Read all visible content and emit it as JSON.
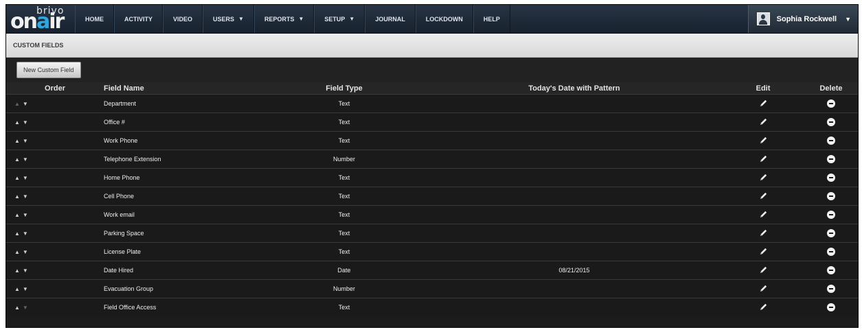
{
  "app": {
    "logo_top": "brivo",
    "logo_main_left": "on",
    "logo_main_accent": "a",
    "logo_main_right": "ir"
  },
  "nav": {
    "items": [
      {
        "label": "HOME",
        "dropdown": false
      },
      {
        "label": "ACTIVITY",
        "dropdown": false
      },
      {
        "label": "VIDEO",
        "dropdown": false
      },
      {
        "label": "USERS",
        "dropdown": true
      },
      {
        "label": "REPORTS",
        "dropdown": true
      },
      {
        "label": "SETUP",
        "dropdown": true
      },
      {
        "label": "JOURNAL",
        "dropdown": false
      },
      {
        "label": "LOCKDOWN",
        "dropdown": false
      },
      {
        "label": "HELP",
        "dropdown": false
      }
    ],
    "user_name": "Sophia Rockwell"
  },
  "page": {
    "title": "CUSTOM FIELDS",
    "new_button": "New Custom Field"
  },
  "table": {
    "headers": {
      "order": "Order",
      "name": "Field Name",
      "type": "Field Type",
      "date": "Today's Date with Pattern",
      "edit": "Edit",
      "delete": "Delete"
    },
    "rows": [
      {
        "name": "Department",
        "type": "Text",
        "date": ""
      },
      {
        "name": "Office #",
        "type": "Text",
        "date": ""
      },
      {
        "name": "Work Phone",
        "type": "Text",
        "date": ""
      },
      {
        "name": "Telephone Extension",
        "type": "Number",
        "date": ""
      },
      {
        "name": "Home Phone",
        "type": "Text",
        "date": ""
      },
      {
        "name": "Cell Phone",
        "type": "Text",
        "date": ""
      },
      {
        "name": "Work email",
        "type": "Text",
        "date": ""
      },
      {
        "name": "Parking Space",
        "type": "Text",
        "date": ""
      },
      {
        "name": "License Plate",
        "type": "Text",
        "date": ""
      },
      {
        "name": "Date Hired",
        "type": "Date",
        "date": "08/21/2015"
      },
      {
        "name": "Evacuation Group",
        "type": "Number",
        "date": ""
      },
      {
        "name": "Field Office Access",
        "type": "Text",
        "date": ""
      }
    ]
  },
  "colors": {
    "nav_bg": "#1f2b39",
    "logo_accent": "#2ea8de",
    "table_bg": "#1a1a1a"
  },
  "icons": {
    "move_up": "up-arrow-icon",
    "move_down": "down-arrow-icon",
    "edit": "pencil-icon",
    "delete": "minus-circle-icon",
    "user": "user-avatar-icon"
  }
}
